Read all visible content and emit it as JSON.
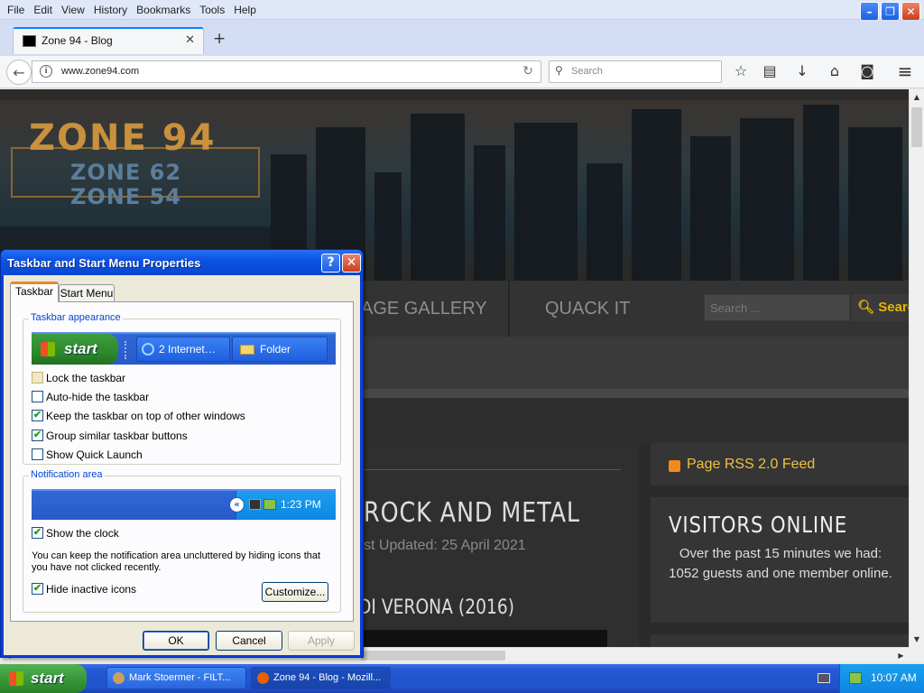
{
  "menubar": {
    "items": [
      "File",
      "Edit",
      "View",
      "History",
      "Bookmarks",
      "Tools",
      "Help"
    ]
  },
  "window_controls": {
    "minimize": "–",
    "maximize": "❐",
    "close": "✕"
  },
  "browser_tab": {
    "title": "Zone 94 - Blog",
    "close": "✕",
    "new_tab": "+"
  },
  "navbar": {
    "url": "www.zone94.com",
    "search_placeholder": "Search",
    "back": "←",
    "info": "i",
    "reload": "↻"
  },
  "toolbar_icons": {
    "bookmark": "☆",
    "reading_list": "▤",
    "downloads": "↓",
    "home": "⌂",
    "pocket": "◙",
    "menu": "≡"
  },
  "site": {
    "logo": {
      "main": "ZONE 94",
      "sub1": "ZONE 62",
      "sub2": "ZONE 54"
    },
    "nav": {
      "gallery": "AGE GALLERY",
      "quack": "QUACK IT"
    },
    "search": {
      "placeholder": "Search ...",
      "button": "Search"
    },
    "article": {
      "title": "ROCK AND METAL",
      "date": "st Updated: 25 April 2021",
      "subtitle": "DI VERONA (2016)"
    },
    "rss": {
      "label": "Page RSS 2.0 Feed"
    },
    "visitors": {
      "title": "VISITORS ONLINE",
      "text": "Over the past 15 minutes we had: 1052 guests and one member online."
    }
  },
  "scrollbar": {
    "up": "▲",
    "down": "▼",
    "left": "◀",
    "right": "▶"
  },
  "dialog": {
    "title": "Taskbar and Start Menu Properties",
    "help": "?",
    "close": "✕",
    "tabs": [
      "Taskbar",
      "Start Menu"
    ],
    "group_appearance": "Taskbar appearance",
    "preview": {
      "start": "start",
      "ie_button": "2 Internet…",
      "folder_button": "Folder"
    },
    "options": [
      {
        "label": "Lock the taskbar",
        "checked": false,
        "disabled": true
      },
      {
        "label": "Auto-hide the taskbar",
        "checked": false,
        "disabled": false
      },
      {
        "label": "Keep the taskbar on top of other windows",
        "checked": true,
        "disabled": false
      },
      {
        "label": "Group similar taskbar buttons",
        "checked": true,
        "disabled": false
      },
      {
        "label": "Show Quick Launch",
        "checked": false,
        "disabled": false
      }
    ],
    "group_notification": "Notification area",
    "notif_time": "1:23 PM",
    "notif_expand": "«",
    "show_clock": {
      "label": "Show the clock",
      "checked": true
    },
    "notif_desc": "You can keep the notification area uncluttered by hiding icons that you have not clicked recently.",
    "hide_inactive": {
      "label": "Hide inactive icons",
      "checked": true
    },
    "buttons": {
      "customize": "Customize...",
      "ok": "OK",
      "cancel": "Cancel",
      "apply": "Apply"
    },
    "check_glyph": "✔"
  },
  "taskbar": {
    "start": "start",
    "tasks": [
      "Mark Stoermer - FILT...",
      "Zone 94 - Blog - Mozill..."
    ],
    "clock": "10:07 AM"
  }
}
